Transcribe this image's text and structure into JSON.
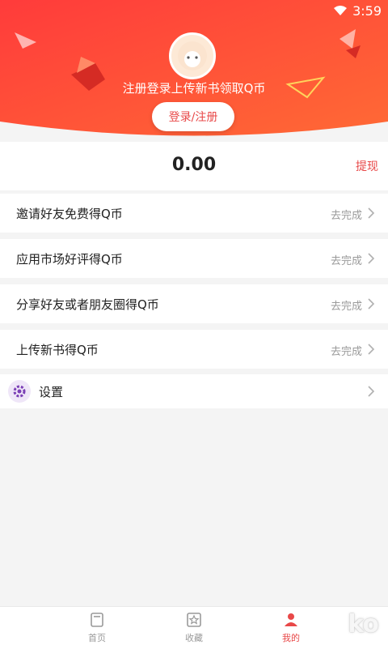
{
  "status_bar": {
    "time": "3:59"
  },
  "header": {
    "promo_text": "注册登录上传新书领取Q币",
    "login_button": "登录/注册",
    "accent_color": "#ff4a3d"
  },
  "balance": {
    "amount": "0.00",
    "withdraw_label": "提现"
  },
  "tasks": [
    {
      "label": "邀请好友免费得Q币",
      "status": "去完成"
    },
    {
      "label": "应用市场好评得Q币",
      "status": "去完成"
    },
    {
      "label": "分享好友或者朋友圈得Q币",
      "status": "去完成"
    },
    {
      "label": "上传新书得Q币",
      "status": "去完成"
    }
  ],
  "settings": {
    "label": "设置",
    "icon": "gear-icon"
  },
  "tabbar": {
    "items": [
      {
        "label": "首页",
        "icon": "book-icon"
      },
      {
        "label": "收藏",
        "icon": "star-icon"
      },
      {
        "label": "我的",
        "icon": "person-icon",
        "active": true
      }
    ]
  },
  "watermark": "ko"
}
